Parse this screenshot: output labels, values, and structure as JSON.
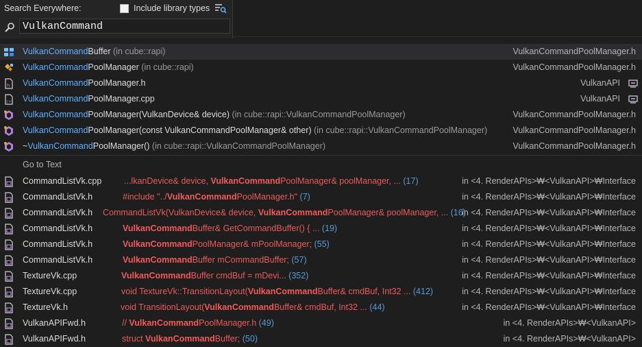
{
  "header": {
    "title": "Search Everywhere:",
    "include_library_label": "Include library types",
    "include_library_checked": false,
    "search_value": "VulkanCommand"
  },
  "symbols": [
    {
      "icon": "struct-icon",
      "prefix": "",
      "match": "VulkanCommand",
      "rest": "Buffer",
      "ns": " (in cube::rapi)",
      "right": "VulkanCommandPoolManager.h",
      "selected": true
    },
    {
      "icon": "class-icon",
      "prefix": "",
      "match": "VulkanCommand",
      "rest": "PoolManager",
      "ns": " (in cube::rapi)",
      "right": "VulkanCommandPoolManager.h",
      "selected": false
    },
    {
      "icon": "header-file-icon",
      "prefix": "",
      "match": "VulkanCommand",
      "rest": "PoolManager.h",
      "ns": "",
      "right": "VulkanAPI",
      "selected": false
    },
    {
      "icon": "cpp-file-icon",
      "prefix": "",
      "match": "VulkanCommand",
      "rest": "PoolManager.cpp",
      "ns": "",
      "right": "VulkanAPI",
      "selected": false
    },
    {
      "icon": "method-icon",
      "prefix": "",
      "match": "VulkanCommand",
      "rest": "PoolManager(VulkanDevice& device)",
      "ns": " (in cube::rapi::VulkanCommandPoolManager)",
      "right": "VulkanCommandPoolManager.h",
      "selected": false
    },
    {
      "icon": "method-icon",
      "prefix": "",
      "match": "VulkanCommand",
      "rest": "PoolManager(const VulkanCommandPoolManager& other)",
      "ns": " (in cube::rapi::VulkanCommandPoolManager)",
      "right": "VulkanCommandPoolManager.h",
      "selected": false
    },
    {
      "icon": "method-icon",
      "prefix": "~",
      "match": "VulkanCommand",
      "rest": "PoolManager()",
      "ns": " (in cube::rapi::VulkanCommandPoolManager)",
      "right": "VulkanCommandPoolManager.h",
      "selected": false
    }
  ],
  "text_section": {
    "title": "Go to Text",
    "results": [
      {
        "file": "CommandListVk.cpp",
        "pre": "...lkanDevice& device, ",
        "match": "VulkanCommand",
        "post": "PoolManager& poolManager, ...",
        "line": " (17)",
        "path": "in <4. RenderAPIs>₩<VulkanAPI>₩Interface"
      },
      {
        "file": "CommandListVk.h",
        "pre": "#include \"../",
        "match": "VulkanCommand",
        "post": "PoolManager.h\"",
        "line": " (7)",
        "path": "in <4. RenderAPIs>₩<VulkanAPI>₩Interface"
      },
      {
        "file": "CommandListVk.h",
        "pre": "CommandListVk(VulkanDevice& device, ",
        "match": "VulkanCommand",
        "post": "PoolManager& poolManager, ...",
        "line": " (16)",
        "path": "in <4. RenderAPIs>₩<VulkanAPI>₩Interface"
      },
      {
        "file": "CommandListVk.h",
        "pre": "",
        "match": "VulkanCommand",
        "post": "Buffer& GetCommandBuffer() { ...",
        "line": " (19)",
        "path": "in <4. RenderAPIs>₩<VulkanAPI>₩Interface"
      },
      {
        "file": "CommandListVk.h",
        "pre": "",
        "match": "VulkanCommand",
        "post": "PoolManager& mPoolManager;",
        "line": " (55)",
        "path": "in <4. RenderAPIs>₩<VulkanAPI>₩Interface"
      },
      {
        "file": "CommandListVk.h",
        "pre": "",
        "match": "VulkanCommand",
        "post": "Buffer mCommandBuffer;",
        "line": " (57)",
        "path": "in <4. RenderAPIs>₩<VulkanAPI>₩Interface"
      },
      {
        "file": "TextureVk.cpp",
        "pre": "",
        "match": "VulkanCommand",
        "post": "Buffer cmdBuf = mDevi...",
        "line": " (352)",
        "path": "in <4. RenderAPIs>₩<VulkanAPI>₩Interface"
      },
      {
        "file": "TextureVk.cpp",
        "pre": "void TextureVk::TransitionLayout(",
        "match": "VulkanCommand",
        "post": "Buffer& cmdBuf, Int32 ...",
        "line": " (412)",
        "path": "in <4. RenderAPIs>₩<VulkanAPI>₩Interface"
      },
      {
        "file": "TextureVk.h",
        "pre": "void TransitionLayout(",
        "match": "VulkanCommand",
        "post": "Buffer& cmdBuf, Int32 ...",
        "line": " (44)",
        "path": "in <4. RenderAPIs>₩<VulkanAPI>₩Interface"
      },
      {
        "file": "VulkanAPIFwd.h",
        "pre": "// ",
        "match": "VulkanCommand",
        "post": "PoolManager.h",
        "line": " (49)",
        "path": "in <4. RenderAPIs>₩<VulkanAPI>"
      },
      {
        "file": "VulkanAPIFwd.h",
        "pre": "struct ",
        "match": "VulkanCommand",
        "post": "Buffer;",
        "line": " (50)",
        "path": "in <4. RenderAPIs>₩<VulkanAPI>"
      }
    ]
  },
  "colors": {
    "background": "#1e1e1e",
    "match_highlight": "#5fb0ff",
    "text_match": "#f35a5a",
    "line_number": "#569cd6",
    "selection": "#2d2d30"
  }
}
